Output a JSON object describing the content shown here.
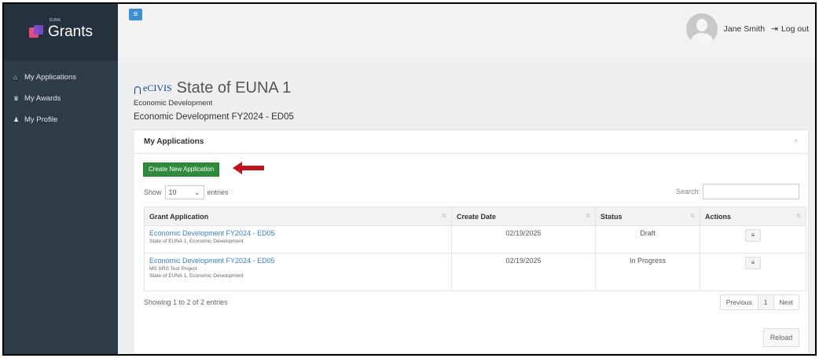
{
  "brand": {
    "small": "EUNA",
    "name": "Grants"
  },
  "sidebar": {
    "items": [
      {
        "label": "My Applications",
        "icon": "home-icon",
        "glyph": "🏠"
      },
      {
        "label": "My Awards",
        "icon": "trophy-icon",
        "glyph": "🏆"
      },
      {
        "label": "My Profile",
        "icon": "user-icon",
        "glyph": "👤"
      }
    ]
  },
  "header": {
    "menu_glyph": "≡",
    "user_name": "Jane Smith",
    "logout_label": "Log out",
    "logout_glyph": "⇥"
  },
  "org": {
    "logo_text": "eCIVIS",
    "name": "State of EUNA 1",
    "department": "Economic Development",
    "program": "Economic Development FY2024 - ED05"
  },
  "panel": {
    "title": "My Applications",
    "collapse_glyph": "^",
    "create_label": "Create New Application",
    "show_label": "Show",
    "entries_value": "10",
    "entries_label": "entries",
    "search_label": "Search:",
    "columns": [
      "Grant Application",
      "Create Date",
      "Status",
      "Actions"
    ],
    "rows": [
      {
        "title": "Economic Development FY2024 - ED05",
        "sub1": "State of EUNA 1, Economic Development",
        "sub2": "",
        "date": "02/19/2025",
        "status": "Draft"
      },
      {
        "title": "Economic Development FY2024 - ED05",
        "sub1": "MS SRS Test Project",
        "sub2": "State of EUNA 1, Economic Development",
        "date": "02/19/2025",
        "status": "In Progress"
      }
    ],
    "info": "Showing 1 to 2 of 2 entries",
    "pager": {
      "prev": "Previous",
      "page": "1",
      "next": "Next"
    },
    "reload_label": "Reload"
  },
  "colors": {
    "sidebar": "#2e3b49",
    "create_button": "#2e8b3a",
    "link": "#3a7fc1",
    "arrow": "#c1141c"
  }
}
